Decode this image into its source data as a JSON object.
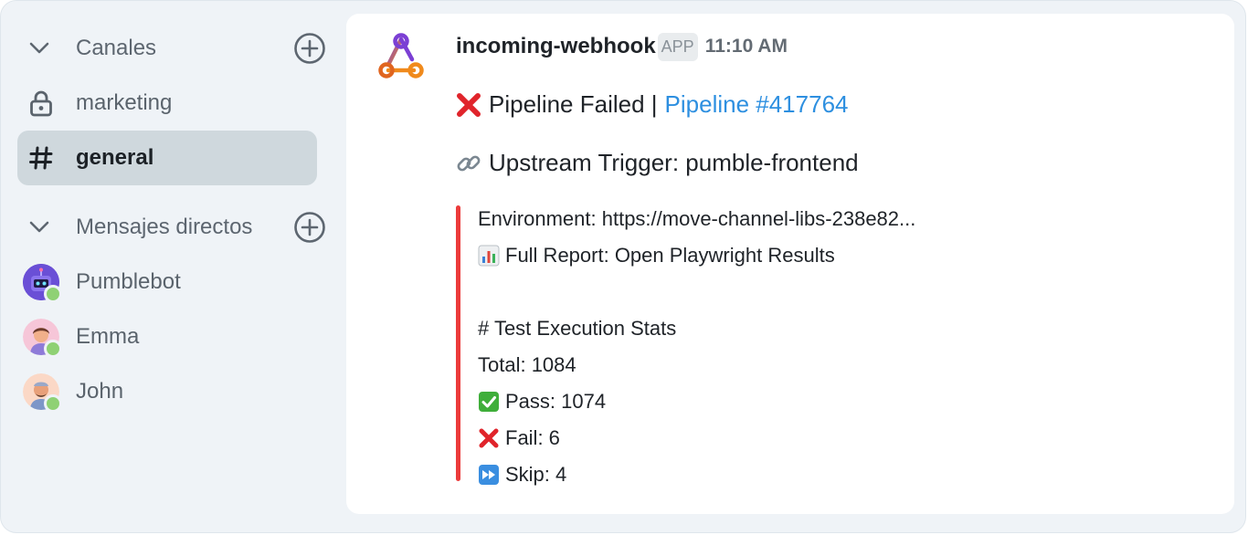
{
  "sidebar": {
    "channels_header": "Canales",
    "channels": [
      {
        "label": "marketing",
        "icon": "lock-icon",
        "active": false
      },
      {
        "label": "general",
        "icon": "hash-icon",
        "active": true
      }
    ],
    "dms_header": "Mensajes directos",
    "dms": [
      {
        "label": "Pumblebot",
        "status": "online"
      },
      {
        "label": "Emma",
        "status": "online"
      },
      {
        "label": "John",
        "status": "online"
      }
    ]
  },
  "message": {
    "sender": "incoming-webhook",
    "badge": "APP",
    "time": "11:10 AM",
    "line1_text": "Pipeline Failed | ",
    "line1_link": "Pipeline #417764",
    "line2_text": "Upstream Trigger: pumble-frontend",
    "attachment": {
      "color": "#ec3b3b",
      "environment": "Environment: https://move-channel-libs-238e82...",
      "report": "Full Report: Open Playwright Results",
      "stats_title": "# Test Execution Stats",
      "total": "Total: 1084",
      "pass": "Pass: 1074",
      "fail": "Fail: 6",
      "skip": "Skip: 4"
    }
  },
  "colors": {
    "accent_link": "#2d8fe0",
    "active_item_bg": "#cfd8dd",
    "presence": "#8fd174"
  }
}
